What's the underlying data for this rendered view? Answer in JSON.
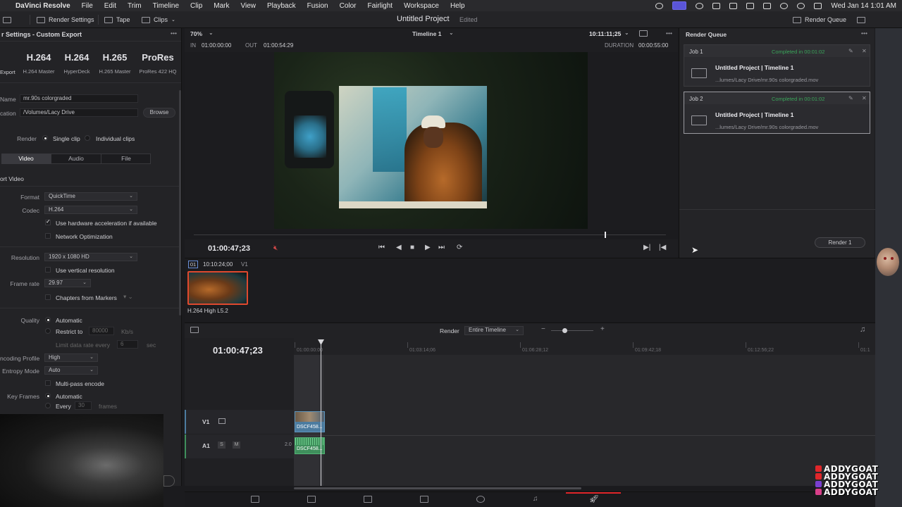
{
  "menubar": {
    "app": "DaVinci Resolve",
    "items": [
      "File",
      "Edit",
      "Trim",
      "Timeline",
      "Clip",
      "Mark",
      "View",
      "Playback",
      "Fusion",
      "Color",
      "Fairlight",
      "Workspace",
      "Help"
    ],
    "datetime": "Wed Jan 14  1:01 AM"
  },
  "toolbar": {
    "render_settings": "Render Settings",
    "tape": "Tape",
    "clips": "Clips",
    "project_title": "Untitled Project",
    "edited": "Edited",
    "render_queue": "Render Queue"
  },
  "left_panel": {
    "title": "r Settings - Custom Export",
    "presets": [
      {
        "big": "",
        "small": "Export"
      },
      {
        "big": "H.264",
        "small": "H.264 Master"
      },
      {
        "big": "H.264",
        "small": "HyperDeck"
      },
      {
        "big": "H.265",
        "small": "H.265 Master"
      },
      {
        "big": "ProRes",
        "small": "ProRes 422 HQ"
      }
    ],
    "name_label": "Name",
    "name_value": "mr.90s colorgraded",
    "location_label": "cation",
    "location_value": "/Volumes/Lacy Drive",
    "browse": "Browse",
    "render_label": "Render",
    "single_clip": "Single clip",
    "individual_clips": "Individual clips",
    "tabs": [
      "Video",
      "Audio",
      "File"
    ],
    "export_video": "ort Video",
    "format_label": "Format",
    "format_value": "QuickTime",
    "codec_label": "Codec",
    "codec_value": "H.264",
    "hw_accel": "Use hardware acceleration if available",
    "network_opt": "Network Optimization",
    "resolution_label": "Resolution",
    "resolution_value": "1920 x 1080 HD",
    "vertical_res": "Use vertical resolution",
    "frame_rate_label": "Frame rate",
    "frame_rate_value": "29.97",
    "chapters": "Chapters from Markers",
    "quality_label": "Quality",
    "quality_auto": "Automatic",
    "restrict_to": "Restrict to",
    "restrict_value": "80000",
    "restrict_unit": "Kb/s",
    "limit_rate": "Limit data rate every",
    "limit_value": "6",
    "limit_unit": "sec",
    "encoding_profile_label": "ncoding Profile",
    "encoding_profile_value": "High",
    "entropy_label": "Entropy Mode",
    "entropy_value": "Auto",
    "multipass": "Multi-pass encode",
    "keyframes_label": "Key Frames",
    "keyframes_auto": "Automatic",
    "every": "Every",
    "every_value": "30",
    "frames": "frames"
  },
  "viewer": {
    "zoom": "70%",
    "timeline_name": "Timeline 1",
    "timecode_top": "10:11:11;25",
    "in_label": "IN",
    "in_value": "01:00:00:00",
    "out_label": "OUT",
    "out_value": "01:00:54:29",
    "duration_label": "DURATION",
    "duration_value": "00:00:55:00",
    "current_tc": "01:00:47;23",
    "scrub_progress": 0.87
  },
  "render_queue": {
    "title": "Render Queue",
    "jobs": [
      {
        "id": "Job 1",
        "status": "Completed in 00:01:02",
        "title": "Untitled Project | Timeline 1",
        "path": "...lumes/Lacy Drive/mr.90s colorgraded.mov"
      },
      {
        "id": "Job 2",
        "status": "Completed in 00:01:02",
        "title": "Untitled Project | Timeline 1",
        "path": "...lumes/Lacy Drive/mr.90s colorgraded.mov"
      }
    ],
    "render_button": "Render 1"
  },
  "media": {
    "clip_index": "01",
    "clip_tc": "10:10:24;00",
    "clip_track": "V1",
    "clip_codec": "H.264 High L5.2"
  },
  "timeline": {
    "render_label": "Render",
    "render_value": "Entire Timeline",
    "timecode": "01:00:47;23",
    "ruler": [
      "01:00:00:00",
      "01:03:14;06",
      "01:06:28;12",
      "01:09:42;18",
      "01:12:56;22",
      "01:1"
    ],
    "v1": "V1",
    "a1": "A1",
    "a1_s": "S",
    "a1_m": "M",
    "a1_ch": "2.0",
    "clip_name": "DSCF458..."
  },
  "overlay": {
    "brand": [
      "ADDYGOAT",
      "ADDYGOAT",
      "ADDYGOAT",
      "ADDYGOAT"
    ],
    "brand_colors": [
      "#e0262a",
      "#e0262a",
      "#7a3fd0",
      "#d83f8a"
    ]
  },
  "colors": {
    "accent_green": "#3aa55a",
    "clip_blue": "#4c7ca0",
    "clip_green": "#3f8f5c",
    "mute_red": "#d94a4a",
    "thumb_border": "#e0492e"
  }
}
